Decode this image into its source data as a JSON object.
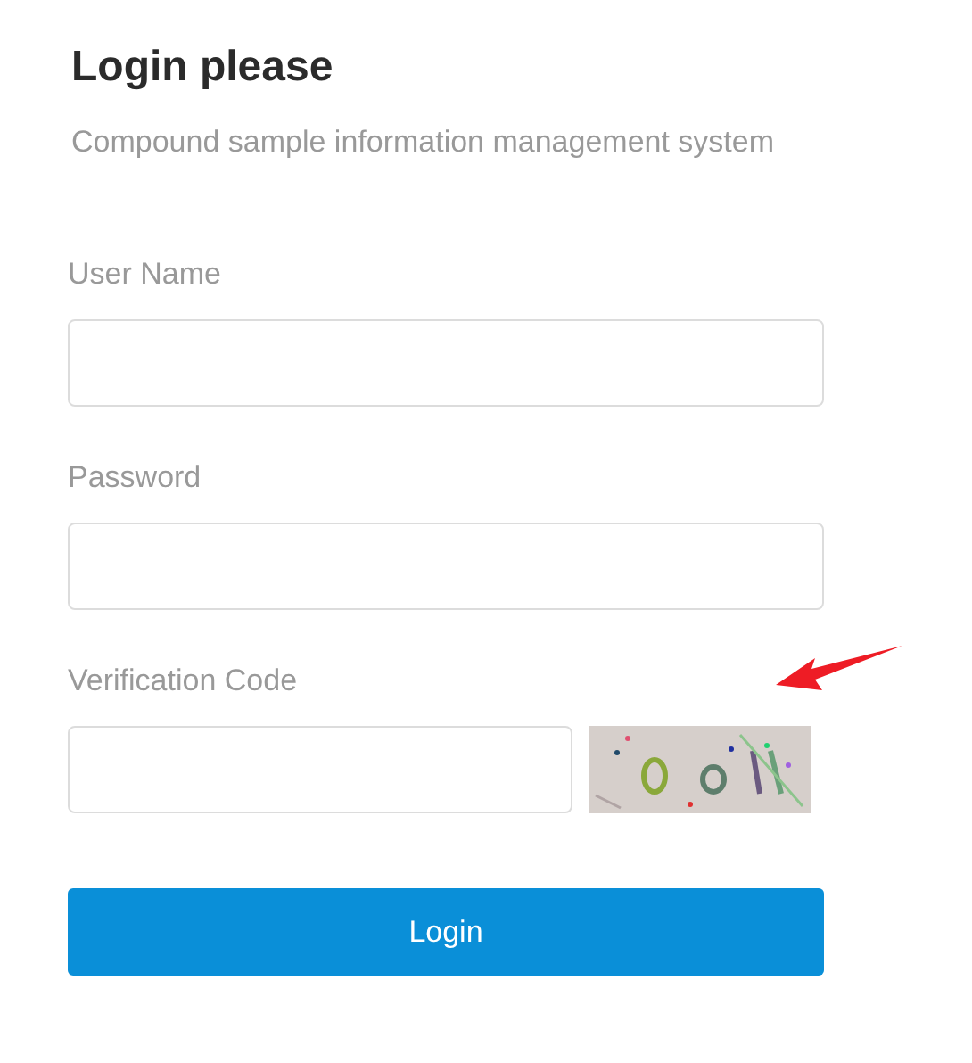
{
  "title": "Login please",
  "subtitle": "Compound sample information management system",
  "fields": [
    {
      "label": "User Name",
      "kind": "text"
    },
    {
      "label": "Password",
      "kind": "password"
    },
    {
      "label": "Verification Code",
      "kind": "captcha"
    }
  ],
  "button": "Login"
}
